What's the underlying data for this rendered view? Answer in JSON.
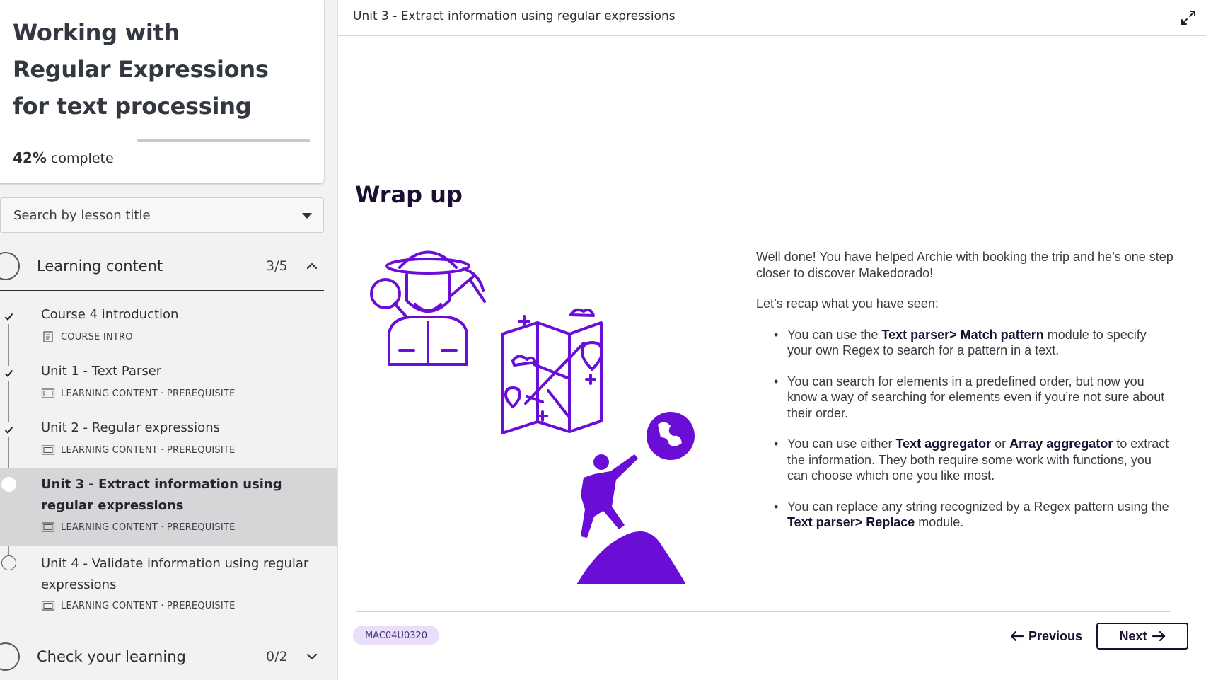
{
  "course": {
    "title": "Working with Regular Expressions for text processing",
    "progress_value": "42%",
    "progress_suffix": " complete",
    "progress_fraction": 0.42
  },
  "search": {
    "label": "Search by lesson title"
  },
  "sections": [
    {
      "title": "Learning content",
      "count": "3/5",
      "expanded": true,
      "lessons": [
        {
          "title": "Course 4 introduction",
          "meta": "COURSE INTRO",
          "status": "done"
        },
        {
          "title": "Unit 1 - Text Parser",
          "meta": "LEARNING CONTENT · PREREQUISITE",
          "status": "done"
        },
        {
          "title": "Unit 2 - Regular expressions",
          "meta": "LEARNING CONTENT · PREREQUISITE",
          "status": "done"
        },
        {
          "title": "Unit 3 - Extract information using regular expressions",
          "meta": "LEARNING CONTENT · PREREQUISITE",
          "status": "current"
        },
        {
          "title": "Unit 4 - Validate information using regular expressions",
          "meta": "LEARNING CONTENT · PREREQUISITE",
          "status": "todo"
        }
      ]
    },
    {
      "title": "Check your learning",
      "count": "0/2",
      "expanded": false
    }
  ],
  "main": {
    "unit_title": "Unit 3 - Extract information using regular expressions",
    "heading": "Wrap up",
    "intro": "Well done! You have helped Archie with booking the trip and he’s one step closer to discover Makedorado!",
    "recap_lead": "Let’s recap what you have seen:",
    "bullets": [
      {
        "pre": "You can use the ",
        "b1": "Text parser> Match pattern",
        "mid": " module to specify your own Regex to search for a pattern in a text.",
        "b2": "",
        "post": ""
      },
      {
        "pre": "You can search for elements in a predefined order, but now you know a way of searching for elements even if you’re not sure about their order.",
        "b1": "",
        "mid": "",
        "b2": "",
        "post": ""
      },
      {
        "pre": "You can use either ",
        "b1": "Text aggregator",
        "mid": " or ",
        "b2": "Array aggregator",
        "post": " to extract the information. They both require some work with functions, you can choose which one you like most."
      },
      {
        "pre": "You can replace any string recognized by a Regex pattern using the ",
        "b1": "Text parser> Replace",
        "mid": " module.",
        "b2": "",
        "post": ""
      }
    ],
    "lesson_code": "MAC04U0320",
    "prev_label": "Previous",
    "next_label": "Next",
    "icons": [
      "expand-icon",
      "check-icon",
      "document-icon",
      "screen-icon",
      "chevron-up-icon",
      "chevron-down-icon",
      "caret-down-icon",
      "arrow-left-icon",
      "arrow-right-icon"
    ],
    "accent_color": "#6a0dd6",
    "text_dark": "#1c0f33"
  }
}
